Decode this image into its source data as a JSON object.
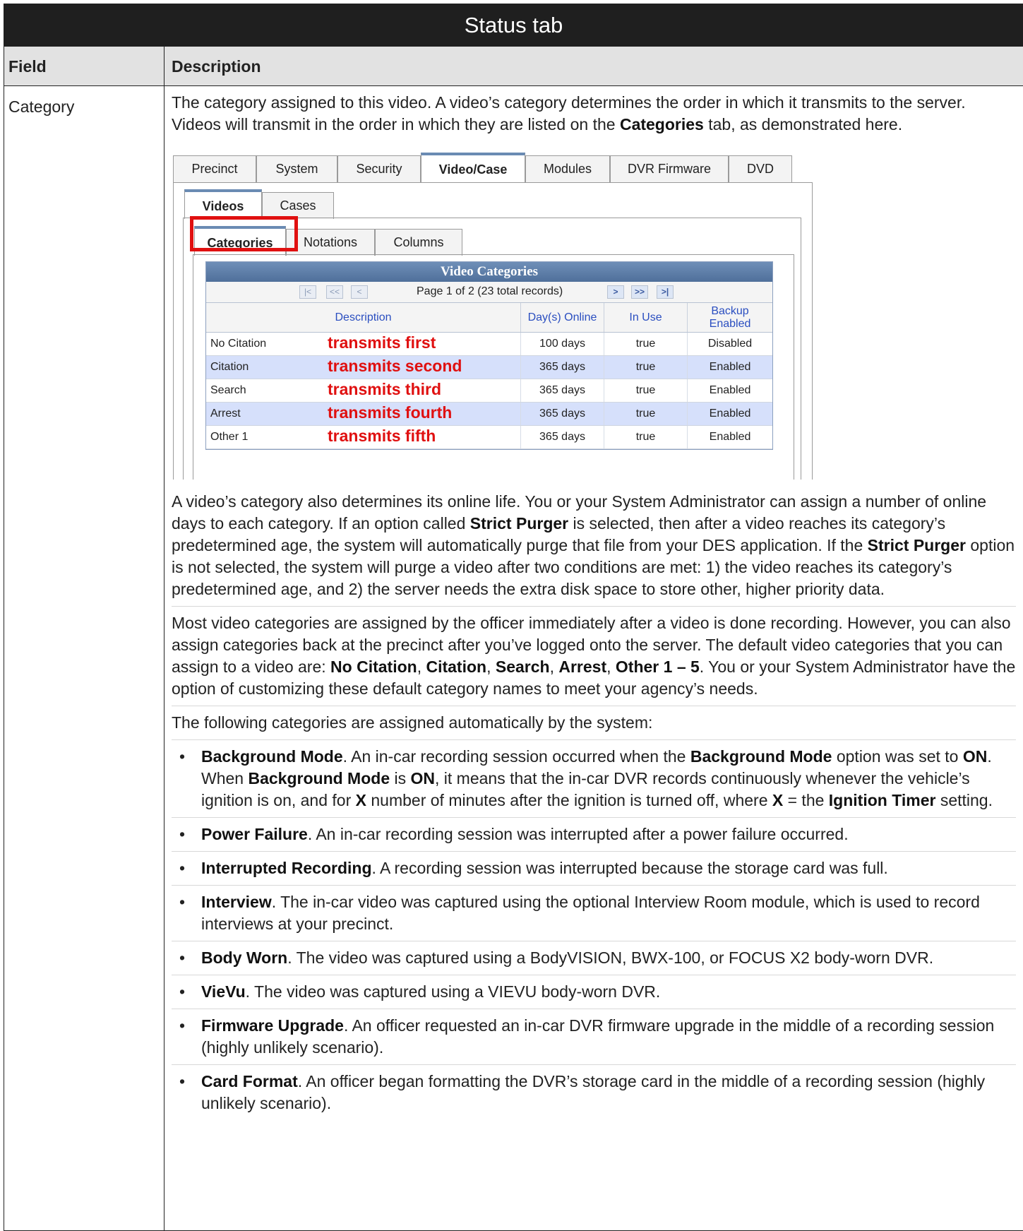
{
  "table": {
    "title": "Status tab",
    "col_field": "Field",
    "col_description": "Description",
    "field_name": "Category"
  },
  "intro": {
    "p1a": "The category assigned to this video. A video’s category determines the order in which it transmits to the server. Videos will transmit in the order in which they are listed on the ",
    "p1b": "Categories",
    "p1c": " tab, as demonstrated here."
  },
  "screenshot": {
    "top_tabs": [
      "Precinct",
      "System",
      "Security",
      "Video/Case",
      "Modules",
      "DVR Firmware",
      "DVD"
    ],
    "sub_tabs": [
      "Videos",
      "Cases"
    ],
    "subsub_tabs": [
      "Categories",
      "Notations",
      "Columns"
    ],
    "table_title": "Video Categories",
    "pager_text": "Page 1 of 2 (23 total records)",
    "pager_first": "|<",
    "pager_prev_page": "<<",
    "pager_prev": "<",
    "pager_next": ">",
    "pager_next_page": ">>",
    "pager_last": ">|",
    "headers": [
      "Description",
      "Day(s) Online",
      "In Use",
      "Backup Enabled"
    ],
    "rows": [
      {
        "desc": "No Citation",
        "note": "transmits first",
        "days": "100 days",
        "in_use": "true",
        "backup": "Disabled"
      },
      {
        "desc": "Citation",
        "note": "transmits second",
        "days": "365 days",
        "in_use": "true",
        "backup": "Enabled"
      },
      {
        "desc": "Search",
        "note": "transmits third",
        "days": "365 days",
        "in_use": "true",
        "backup": "Enabled"
      },
      {
        "desc": "Arrest",
        "note": "transmits fourth",
        "days": "365 days",
        "in_use": "true",
        "backup": "Enabled"
      },
      {
        "desc": "Other 1",
        "note": "transmits fifth",
        "days": "365 days",
        "in_use": "true",
        "backup": "Enabled"
      }
    ],
    "highlight_color": "#e01010",
    "accent_color": "#4f6f9a"
  },
  "paragraphs": {
    "p2a": "A video’s category also determines its online life. You or your System Administrator can assign a number of online days to each category. If an option called ",
    "p2b": "Strict Purger",
    "p2c": " is selected, then after a video reaches its category’s predetermined age, the system will automatically purge that file from your DES application. If the ",
    "p2d": "Strict Purger",
    "p2e": " option is not selected, the system will purge a video after two conditions are met: 1) the video reaches its category’s predetermined age, and 2) the server needs the extra disk space to store other, higher priority data.",
    "p3a": "Most video categories are assigned by the officer immediately after a video is done recording. However, you can also assign categories back at the precinct after you’ve logged onto the server. The default video categories that you can assign to a video are: ",
    "p3b": "No Citation",
    "p3c": ", ",
    "p3d": "Citation",
    "p3e": ", ",
    "p3f": "Search",
    "p3g": ", ",
    "p3h": "Arrest",
    "p3i": ", ",
    "p3j": "Other 1 – 5",
    "p3k": ". You or your System Administrator have the option of customizing these default category names to meet your agency’s needs.",
    "p4": "The following categories are assigned automatically by the system:"
  },
  "bullets": {
    "b1": {
      "t1": "Background Mode",
      "t2": ". An in-car recording session occurred when the ",
      "t3": "Background Mode",
      "t4": " option was set to ",
      "t5": "ON",
      "t6": ". When ",
      "t7": "Background Mode",
      "t8": " is ",
      "t9": "ON",
      "t10": ", it means that the in-car DVR records continuously whenever the vehicle’s ignition is on, and for ",
      "t11": "X",
      "t12": " number of minutes after the ignition is turned off, where ",
      "t13": "X",
      "t14": " = the ",
      "t15": "Ignition Timer",
      "t16": " setting."
    },
    "b2": {
      "t1": "Power Failure",
      "t2": ". An in-car recording session was interrupted after a power failure occurred."
    },
    "b3": {
      "t1": "Interrupted Recording",
      "t2": ". A recording session was interrupted because the storage card was full."
    },
    "b4": {
      "t1": "Interview",
      "t2": ". The in-car video was captured using the optional Interview Room module, which is used to record interviews at your precinct."
    },
    "b5": {
      "t1": "Body Worn",
      "t2": ". The video was captured using a BodyVISION, BWX-100, or FOCUS X2 body-worn DVR."
    },
    "b6": {
      "t1": "VieVu",
      "t2": ". The video was captured using a VIEVU body-worn DVR."
    },
    "b7": {
      "t1": "Firmware Upgrade",
      "t2": ". An officer requested an in-car DVR firmware upgrade in the middle of a recording session (highly unlikely scenario)."
    },
    "b8": {
      "t1": "Card Format",
      "t2": ". An officer began formatting the DVR’s storage card in the middle of a recording session (highly unlikely scenario)."
    },
    "bullet_char": "•"
  }
}
